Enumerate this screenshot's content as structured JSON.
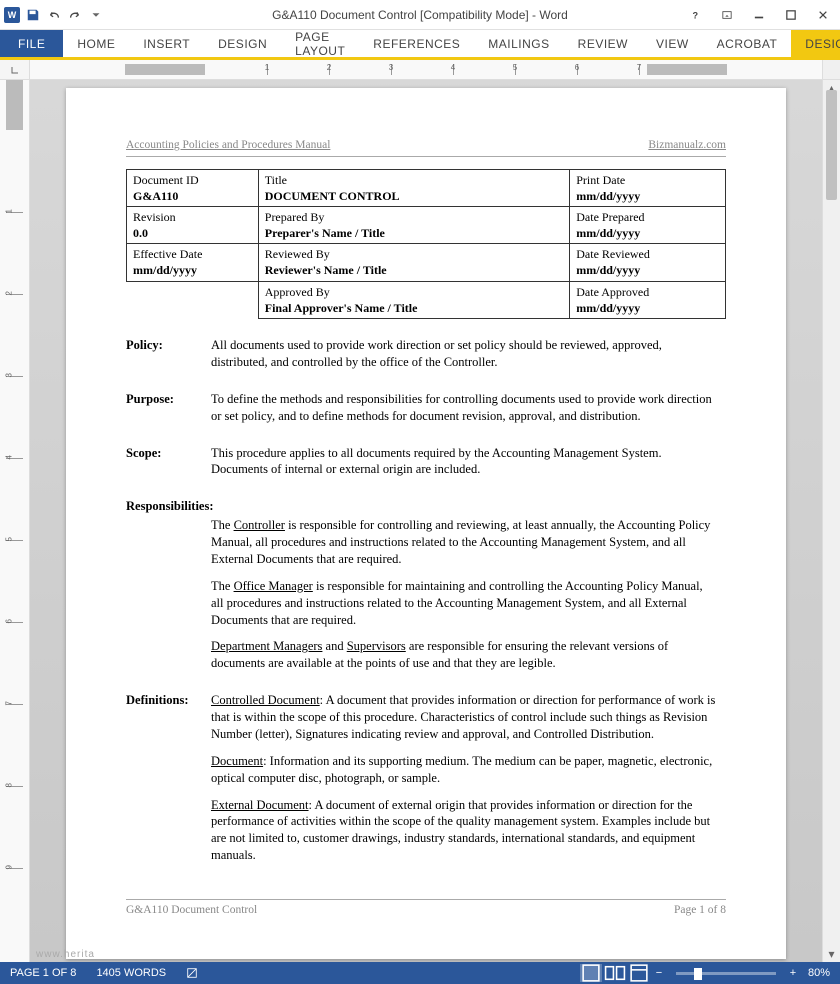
{
  "titlebar": {
    "title": "G&A110 Document Control [Compatibility Mode] - Word"
  },
  "ribbon": {
    "tabs": [
      "FILE",
      "HOME",
      "INSERT",
      "DESIGN",
      "PAGE LAYOUT",
      "REFERENCES",
      "MAILINGS",
      "REVIEW",
      "VIEW",
      "ACROBAT"
    ],
    "design_right": "DESIGN"
  },
  "ruler": {
    "h_marks": [
      "1",
      "2",
      "3",
      "4",
      "5",
      "6",
      "7"
    ],
    "v_marks": [
      "1",
      "2",
      "3",
      "4",
      "5",
      "6",
      "7",
      "8",
      "9"
    ]
  },
  "document": {
    "header_left": "Accounting Policies and Procedures Manual",
    "header_right": "Bizmanualz.com",
    "table": [
      [
        {
          "label": "Document ID",
          "value": "G&A110"
        },
        {
          "label": "Title",
          "value": "DOCUMENT CONTROL"
        },
        {
          "label": "Print Date",
          "value": "mm/dd/yyyy"
        }
      ],
      [
        {
          "label": "Revision",
          "value": "0.0"
        },
        {
          "label": "Prepared By",
          "value": "Preparer's Name / Title"
        },
        {
          "label": "Date Prepared",
          "value": "mm/dd/yyyy"
        }
      ],
      [
        {
          "label": "Effective Date",
          "value": "mm/dd/yyyy"
        },
        {
          "label": "Reviewed By",
          "value": "Reviewer's Name / Title"
        },
        {
          "label": "Date Reviewed",
          "value": "mm/dd/yyyy"
        }
      ],
      [
        {
          "label": "",
          "value": ""
        },
        {
          "label": "Approved By",
          "value": "Final Approver's Name / Title"
        },
        {
          "label": "Date Approved",
          "value": "mm/dd/yyyy"
        }
      ]
    ],
    "sections": {
      "policy": {
        "label": "Policy:",
        "text": "All documents used to provide work direction or set policy should be reviewed, approved, distributed, and controlled by the office of the Controller."
      },
      "purpose": {
        "label": "Purpose:",
        "text": "To define the methods and responsibilities for controlling documents used to provide work direction or set policy, and to define methods for document revision, approval, and distribution."
      },
      "scope": {
        "label": "Scope:",
        "text": "This procedure applies to all documents required by the Accounting Management System.  Documents of internal or external origin are included."
      },
      "responsibilities": {
        "label": "Responsibilities:",
        "p1_pre": "The ",
        "p1_u": "Controller",
        "p1_post": " is responsible for controlling and reviewing, at least annually, the Accounting Policy Manual, all procedures and instructions related to the Accounting Management System, and all External Documents that are required.",
        "p2_pre": "The ",
        "p2_u": "Office Manager",
        "p2_post": " is responsible for maintaining and controlling the Accounting Policy Manual, all procedures and instructions related to the Accounting Management System, and all External Documents that are required.",
        "p3_u1": "Department Managers",
        "p3_mid": " and ",
        "p3_u2": "Supervisors",
        "p3_post": " are responsible for ensuring the relevant versions of documents are available at the points of use and that they are legible."
      },
      "definitions": {
        "label": "Definitions:",
        "d1_u": "Controlled Document",
        "d1_post": ":  A document that provides information or direction for performance of work is that is within the scope of this procedure.  Characteristics of control include such things as Revision Number (letter), Signatures indicating review and approval, and Controlled Distribution.",
        "d2_u": "Document",
        "d2_post": ":  Information and its supporting medium.  The medium can be paper, magnetic, electronic, optical computer disc, photograph, or sample.",
        "d3_u": "External Document",
        "d3_post": ":  A document of external origin that provides information or direction for the performance of activities within the scope of the quality management system.  Examples include but are not limited to, customer drawings, industry standards, international standards, and equipment manuals."
      }
    },
    "footer_left": "G&A110 Document Control",
    "footer_right": "Page 1 of 8"
  },
  "statusbar": {
    "page": "PAGE 1 OF 8",
    "words": "1405 WORDS",
    "zoom": "80%"
  },
  "watermark": "www.herita"
}
